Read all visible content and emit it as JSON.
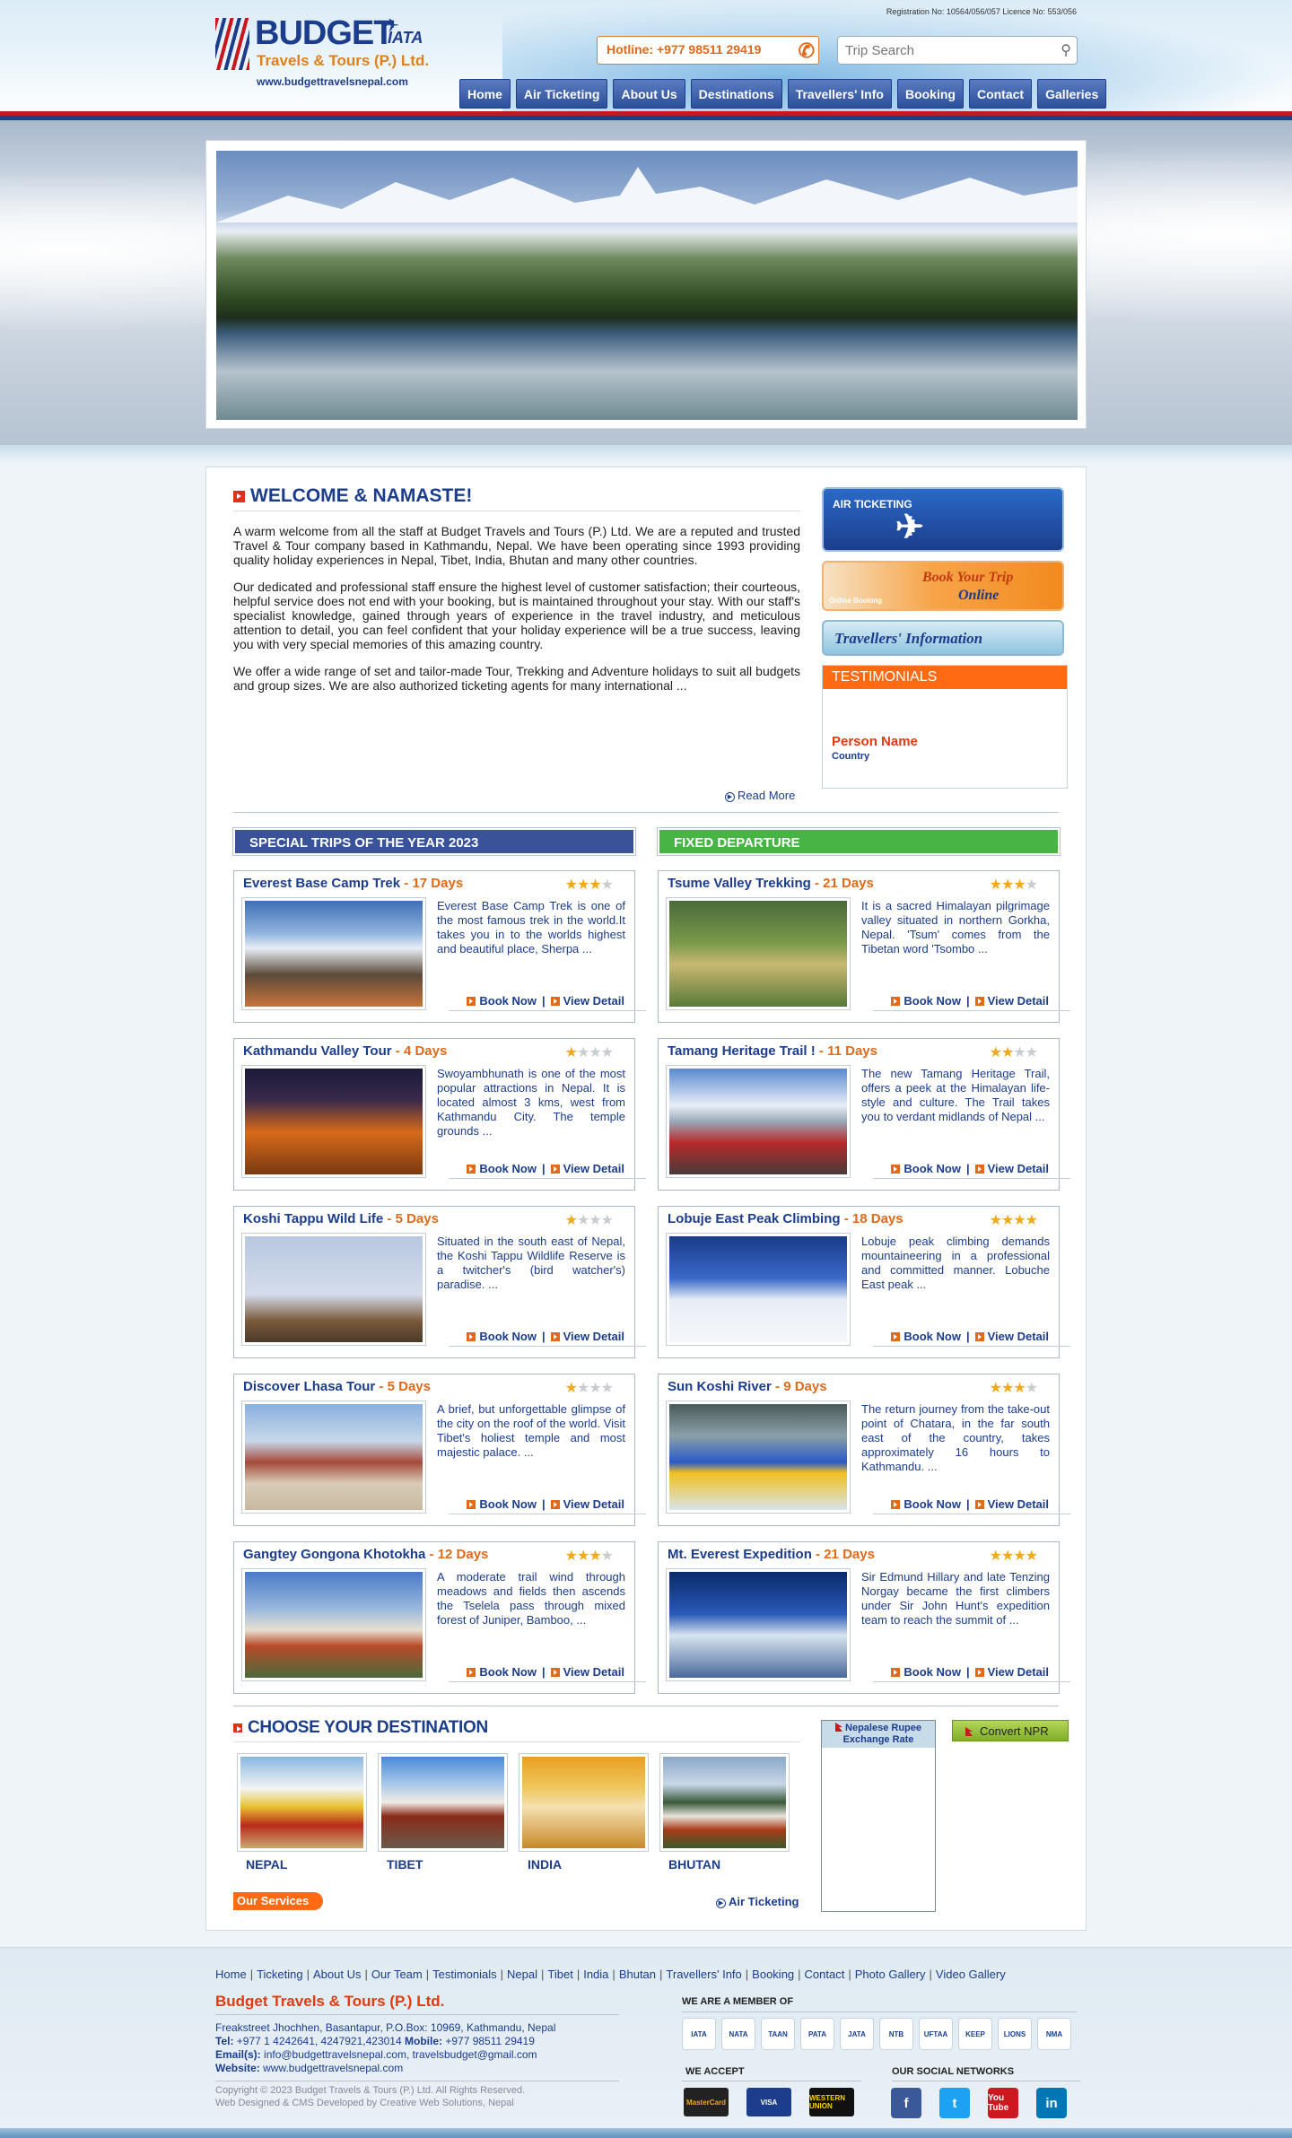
{
  "header": {
    "logo_text": "BUDGET",
    "logo_iata": "IATA",
    "logo_sub": "Travels & Tours (P.) Ltd.",
    "logo_url": "www.budgettravelsnepal.com",
    "registration": "Registration No: 10564/056/057 Licence No: 553/056",
    "hotline": "Hotline: +977 98511 29419",
    "search_placeholder": "Trip Search"
  },
  "nav": [
    "Home",
    "Air Ticketing",
    "About Us",
    "Destinations",
    "Travellers' Info",
    "Booking",
    "Contact",
    "Galleries"
  ],
  "welcome": {
    "title": "WELCOME & NAMASTE!",
    "paragraphs": [
      "A warm welcome from all the staff at Budget Travels and Tours (P.) Ltd. We are a reputed and trusted Travel & Tour company based in Kathmandu, Nepal. We have been operating since 1993 providing quality holiday experiences in Nepal, Tibet, India, Bhutan and many other countries.",
      "Our dedicated and professional staff ensure the highest level of customer satisfaction; their courteous, helpful service does not end with your booking, but is maintained throughout your stay. With our staff's specialist knowledge, gained through years of experience in the travel industry, and meticulous attention to detail, you can feel confident that your holiday experience will be a true success, leaving you with very special memories of this amazing country.",
      "We offer a wide range of set and tailor-made Tour, Trekking and Adventure holidays to suit all budgets and group sizes. We are also authorized ticketing agents for many international ..."
    ],
    "read_more": "Read More"
  },
  "sidebar": {
    "air_ticketing": "AIR TICKETING",
    "book_line1": "Book Your Trip",
    "book_line2": "Online",
    "book_small": "Online Booking",
    "travellers_info": "Travellers' Information",
    "testimonials_title": "TESTIMONIALS",
    "testimonial_name": "Person Name",
    "testimonial_country": "Country"
  },
  "special": {
    "title": "SPECIAL TRIPS OF THE YEAR 2023",
    "trips": [
      {
        "name": "Everest Base Camp Trek",
        "days": "17 Days",
        "stars": 3,
        "desc": "Everest Base Camp Trek is one of the most famous trek in the world.It takes you in to the worlds highest and beautiful place, Sherpa ...",
        "img": "everest"
      },
      {
        "name": "Kathmandu Valley Tour",
        "days": "4 Days",
        "stars": 1,
        "desc": "Swoyambhunath is one of the most popular attractions in Nepal. It is located almost 3 kms, west from Kathmandu City. The temple grounds ...",
        "img": "kathmandu"
      },
      {
        "name": "Koshi Tappu Wild Life",
        "days": "5 Days",
        "stars": 1,
        "desc": "Situated in the south east of Nepal, the Koshi Tappu Wildlife Reserve is a twitcher's (bird watcher's) paradise. ...",
        "img": "bird"
      },
      {
        "name": "Discover Lhasa Tour",
        "days": "5 Days",
        "stars": 1,
        "desc": "A brief, but unforgettable glimpse of the city on the roof of the world. Visit Tibet's holiest temple and most majestic palace. ...",
        "img": "lhasa"
      },
      {
        "name": "Gangtey Gongona Khotokha",
        "days": "12 Days",
        "stars": 3,
        "desc": "A moderate trail wind through meadows and fields then ascends the Tselela pass through mixed forest of Juniper, Bamboo, ...",
        "img": "bhutan"
      }
    ]
  },
  "fixed": {
    "title": "FIXED DEPARTURE",
    "trips": [
      {
        "name": "Tsume Valley Trekking",
        "days": "21 Days",
        "stars": 3,
        "desc": "It is a sacred Himalayan pilgrimage valley situated in northern Gorkha, Nepal. 'Tsum' comes from the Tibetan word 'Tsombo ...",
        "img": "valley"
      },
      {
        "name": "Tamang Heritage Trail !",
        "days": "11 Days",
        "stars": 2,
        "desc": "The new Tamang Heritage Trail, offers a peek at the Himalayan life-style and culture. The Trail takes you to verdant midlands of Nepal ...",
        "img": "tamang"
      },
      {
        "name": "Lobuje East Peak Climbing",
        "days": "18 Days",
        "stars": 4,
        "desc": "Lobuje peak climbing demands mountaineering in a professional and committed manner. Lobuche East peak ...",
        "img": "lobuje"
      },
      {
        "name": "Sun Koshi River",
        "days": "9 Days",
        "stars": 3,
        "desc": "The return journey from the take-out point of Chatara, in the far south east of the country, takes approximately 16 hours to Kathmandu. ...",
        "img": "raft"
      },
      {
        "name": "Mt. Everest Expedition",
        "days": "21 Days",
        "stars": 4,
        "desc": "Sir Edmund Hillary and late Tenzing Norgay became the first climbers under Sir John Hunt's expedition team to reach the summit of ...",
        "img": "summit"
      }
    ]
  },
  "trip_links": {
    "book": "Book Now",
    "detail": "View Detail"
  },
  "destinations": {
    "title": "CHOOSE YOUR DESTINATION",
    "items": [
      {
        "name": "NEPAL",
        "img": "stupa"
      },
      {
        "name": "TIBET",
        "img": "potala"
      },
      {
        "name": "INDIA",
        "img": "taj"
      },
      {
        "name": "BHUTAN",
        "img": "dzong"
      }
    ],
    "services": "Our Services",
    "air_link": "Air Ticketing"
  },
  "exchange": {
    "title_line1": "Nepalese Rupee",
    "title_line2": "Exchange Rate",
    "convert": "Convert NPR"
  },
  "footer": {
    "links": [
      "Home",
      "Ticketing",
      "About Us",
      "Our Team",
      "Testimonials",
      "Nepal",
      "Tibet",
      "India",
      "Bhutan",
      "Travellers' Info",
      "Booking",
      "Contact",
      "Photo Gallery",
      "Video Gallery"
    ],
    "company": "Budget Travels & Tours (P.) Ltd.",
    "address": "Freakstreet Jhochhen, Basantapur, P.O.Box: 10969, Kathmandu, Nepal",
    "tel_label": "Tel:",
    "tel": "+977 1 4242641, 4247921,423014",
    "mobile_label": "Mobile:",
    "mobile": "+977 98511 29419",
    "email_label": "Email(s):",
    "email": "info@budgettravelsnepal.com, travelsbudget@gmail.com",
    "website_label": "Website:",
    "website": "www.budgettravelsnepal.com",
    "copyright": "Copyright © 2023 Budget Travels & Tours (P.) Ltd. All Rights Reserved.",
    "developer": "Web Designed & CMS Developed by Creative Web Solutions, Nepal",
    "member_title": "WE ARE A MEMBER OF",
    "members": [
      "IATA",
      "NATA",
      "TAAN",
      "PATA",
      "JATA",
      "NTB",
      "UFTAA",
      "KEEP",
      "LIONS",
      "NMA"
    ],
    "accept_title": "WE ACCEPT",
    "cards": [
      "MasterCard",
      "VISA",
      "WESTERN UNION"
    ],
    "social_title": "OUR SOCIAL NETWORKS",
    "social": [
      "f",
      "t",
      "You Tube",
      "in"
    ]
  },
  "colors": {
    "brand_blue": "#1c3d8c",
    "accent_orange": "#e0691a",
    "brand_red": "#c7181f",
    "fixed_green": "#48b445"
  }
}
